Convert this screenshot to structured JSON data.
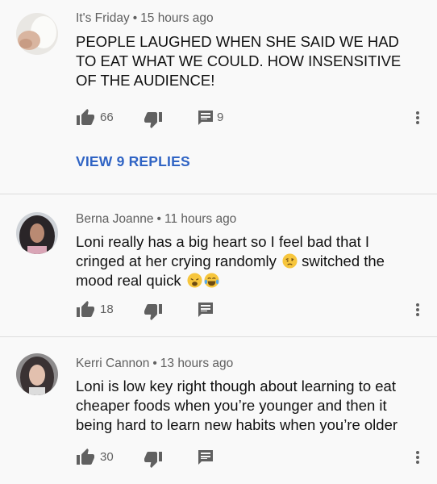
{
  "comments": [
    {
      "author": "It's Friday",
      "time": "15 hours ago",
      "text": "PEOPLE LAUGHED WHEN SHE SAID WE HAD TO EAT WHAT WE COULD. HOW INSENSITIVE OF THE AUDIENCE!",
      "likes": "66",
      "replies": "9",
      "view_replies": "VIEW 9 REPLIES"
    },
    {
      "author": "Berna Joanne",
      "time": "11 hours ago",
      "text_a": "Loni really has a big heart so I feel bad that I cringed at her crying randomly",
      "text_b": "switched the mood real quick",
      "likes": "18"
    },
    {
      "author": "Kerri Cannon",
      "time": "13 hours ago",
      "text": "Loni is low key right though about learning to eat cheaper foods when you’re younger and then it being hard to learn new habits when you’re older",
      "likes": "30"
    }
  ],
  "separator": "•",
  "icons": {
    "like": "thumbs-up-icon",
    "dislike": "thumbs-down-icon",
    "reply": "reply-comment-icon",
    "more": "more-vertical-icon",
    "emoji_1": "woozy-face-emoji",
    "emoji_2": "weary-face-emoji",
    "emoji_3": "tears-of-joy-emoji"
  },
  "colors": {
    "background": "#f9f9f9",
    "link": "#3064c4",
    "meta": "#606060",
    "icon": "#606060"
  }
}
